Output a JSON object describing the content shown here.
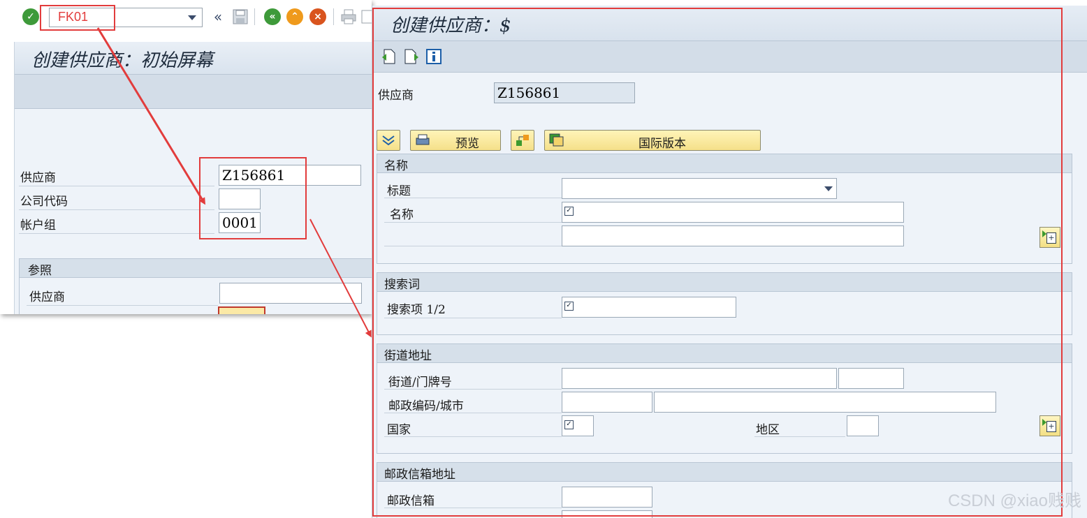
{
  "toolbar": {
    "command_value": "FK01",
    "icons": [
      "enter-icon",
      "collapse-icon",
      "save-icon",
      "back-icon",
      "exit-icon",
      "cancel-icon",
      "print-icon",
      "find-icon"
    ]
  },
  "left_window": {
    "title": "创建供应商：初始屏幕",
    "fields": {
      "vendor_label": "供应商",
      "vendor_value": "Z156861",
      "company_code_label": "公司代码",
      "company_code_value": "",
      "account_group_label": "帐户组",
      "account_group_value": "0001"
    },
    "reference": {
      "header": "参照",
      "vendor_label": "供应商",
      "vendor_value": ""
    }
  },
  "right_window": {
    "title": "创建供应商：$",
    "app_icons": [
      "previous-screen-icon",
      "next-screen-icon",
      "info-icon"
    ],
    "vendor_label": "供应商",
    "vendor_value": "Z156861",
    "buttons": {
      "preview": "预览",
      "international": "国际版本"
    },
    "name_group": {
      "header": "名称",
      "title_label": "标题",
      "title_value": "",
      "name_label": "名称",
      "name_value": "",
      "name2_value": ""
    },
    "search_group": {
      "header": "搜索词",
      "search_label": "搜索项 1/2",
      "search_value": ""
    },
    "street_group": {
      "header": "街道地址",
      "street_label": "街道/门牌号",
      "postal_city_label": "邮政编码/城市",
      "country_label": "国家",
      "region_label": "地区"
    },
    "pobox_group": {
      "header": "邮政信箱地址",
      "pobox_label": "邮政信箱"
    }
  },
  "colors": {
    "annotation_red": "#e23c3c",
    "panel_bg": "#eef3f9",
    "header_bg": "#d6e0ea",
    "button_yellow": "#f5e08a"
  },
  "watermark": "CSDN @xiao贱贱"
}
